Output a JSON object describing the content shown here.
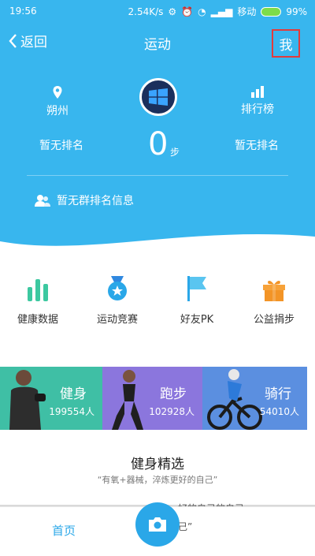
{
  "status_bar": {
    "time": "19:56",
    "speed": "2.54K/s",
    "carrier": "移动",
    "battery": "99%"
  },
  "nav": {
    "back_label": "返回",
    "title": "运动",
    "me_label": "我"
  },
  "hero": {
    "location": "朔州",
    "leaderboard": "排行榜",
    "left_rank": "暂无排名",
    "right_rank": "暂无排名",
    "steps": "0",
    "steps_unit": "步",
    "group_info": "暂无群排名信息"
  },
  "quick_actions": [
    {
      "label": "健康数据",
      "icon": "health-data-icon"
    },
    {
      "label": "运动竞赛",
      "icon": "medal-icon"
    },
    {
      "label": "好友PK",
      "icon": "flag-icon"
    },
    {
      "label": "公益捐步",
      "icon": "gift-icon"
    }
  ],
  "categories": [
    {
      "name": "健身",
      "count": "199554人",
      "color": "#3fbfa5"
    },
    {
      "name": "跑步",
      "count": "102928人",
      "color": "#8b76dd"
    },
    {
      "name": "骑行",
      "count": "54010人",
      "color": "#5b8fe0"
    }
  ],
  "featured": {
    "title": "健身精选",
    "subtitle": "“有氧+器械，淬炼更好的自己”"
  },
  "tabbar": {
    "home": "首页"
  },
  "ghost_text": {
    "top": "好的自己的自己",
    "bottom": "己”"
  },
  "colors": {
    "hero_bg": "#38b6ee",
    "accent": "#2aa7e8",
    "me_border": "#e23b3b"
  }
}
